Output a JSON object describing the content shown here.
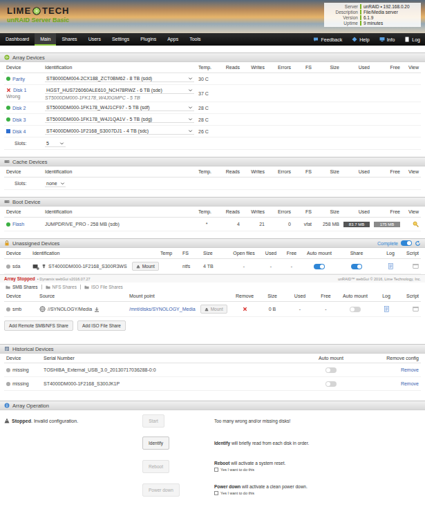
{
  "header": {
    "logo_left": "LIME",
    "logo_right": "TECH",
    "product": "unRAID Server Basic",
    "server_info": [
      {
        "label": "Server",
        "value": "unRAID • 192.168.0.20"
      },
      {
        "label": "Description",
        "value": "File/Media server"
      },
      {
        "label": "Version",
        "value": "6.1.9"
      },
      {
        "label": "Uptime",
        "value": "9 minutes"
      }
    ]
  },
  "nav": {
    "tabs": [
      {
        "label": "Dashboard",
        "selected": false
      },
      {
        "label": "Main",
        "selected": true
      },
      {
        "label": "Shares",
        "selected": false
      },
      {
        "label": "Users",
        "selected": false
      },
      {
        "label": "Settings",
        "selected": false
      },
      {
        "label": "Plugins",
        "selected": false
      },
      {
        "label": "Apps",
        "selected": false
      },
      {
        "label": "Tools",
        "selected": false
      }
    ],
    "links": [
      "Feedback",
      "Help",
      "Info",
      "Log"
    ]
  },
  "array_devices": {
    "title": "Array Devices",
    "columns": [
      "Device",
      "Identification",
      "Temp.",
      "Reads",
      "Writes",
      "Errors",
      "FS",
      "Size",
      "Used",
      "Free",
      "View"
    ],
    "rows": [
      {
        "device": "Parity",
        "kind": "dot",
        "color": "#3cb043",
        "identification": "ST8000DM004-2CX188_ZCT0BM62 - 8 TB (sdd)",
        "temp": "30 C"
      },
      {
        "device": "Disk 1",
        "kind": "cross",
        "color": "#d9302c",
        "identification": "HGST_HUS726060ALE610_NCH78RWZ - 6 TB (sde)",
        "temp": "37 C",
        "note": "Wrong",
        "note_detail": "ST5000DM000-1FK178_W4J0GMPC - 5 TB"
      },
      {
        "device": "Disk 2",
        "kind": "dot",
        "color": "#3cb043",
        "identification": "ST5000DM000-1FK178_W4J1CF97 - 5 TB (sdf)",
        "temp": "28 C"
      },
      {
        "device": "Disk 3",
        "kind": "dot",
        "color": "#3cb043",
        "identification": "ST5000DM000-1FK178_W4J1QA1V - 5 TB (sdg)",
        "temp": "28 C"
      },
      {
        "device": "Disk 4",
        "kind": "square",
        "color": "#2f6fd0",
        "identification": "ST4000DM000-1F2168_S3007DJ1 - 4 TB (sdc)",
        "temp": "26 C"
      }
    ],
    "slots": {
      "label": "Slots:",
      "value": "5"
    }
  },
  "cache_devices": {
    "title": "Cache Devices",
    "columns": [
      "Device",
      "Identification",
      "Temp.",
      "Reads",
      "Writes",
      "Errors",
      "FS",
      "Size",
      "Used",
      "Free",
      "View"
    ],
    "slots": {
      "label": "Slots:",
      "value": "none"
    }
  },
  "boot_device": {
    "title": "Boot Device",
    "columns": [
      "Device",
      "Identification",
      "Temp.",
      "Reads",
      "Writes",
      "Errors",
      "FS",
      "Size",
      "Used",
      "Free",
      "View"
    ],
    "rows": [
      {
        "device": "Flash",
        "identification": "JUMPDRIVE_PRO - 258 MB (sdb)",
        "temp": "*",
        "reads": "4",
        "writes": "21",
        "errors": "0",
        "fs": "vfat",
        "size": "258 MB",
        "used": "83.7 MB",
        "free": "175 MB"
      }
    ]
  },
  "unassigned_devices": {
    "title": "Unassigned Devices",
    "status": "Complete",
    "status_on": true,
    "columns": [
      "Device",
      "Identification",
      "Temp",
      "FS",
      "Size",
      "Open files",
      "Used",
      "Free",
      "Auto mount",
      "Share",
      "Log",
      "Script"
    ],
    "rows": [
      {
        "device": "sda",
        "identification": "ST4000DM000-1F2168_S300R3WS",
        "button": "Mount",
        "temp": "",
        "fs": "ntfs",
        "size": "4 TB",
        "open_files": "-",
        "used": "-",
        "free": "-",
        "auto_mount": true,
        "share": true
      }
    ]
  },
  "status_bar": {
    "state": "Array Stopped",
    "version": "• Dynamix webGui v2016.07.27",
    "copyright": "unRAID™ webGui © 2016, Lime Technology, Inc."
  },
  "share_tabs": [
    {
      "label": "SMB Shares",
      "selected": true
    },
    {
      "label": "NFS Shares",
      "selected": false
    },
    {
      "label": "ISO File Shares",
      "selected": false
    }
  ],
  "remote_shares": {
    "columns": [
      "Device",
      "Source",
      "Mount point",
      "Remove",
      "Size",
      "Used",
      "Free",
      "Auto mount",
      "Log",
      "Script"
    ],
    "rows": [
      {
        "device": "smb",
        "source": "//SYNOLOGY/Media",
        "mount_point": "/mnt/disks/SYNOLOGY_Media",
        "button": "Mount",
        "button_disabled": true,
        "size": "0 B",
        "used": "-",
        "free": "-",
        "auto_mount": false
      }
    ],
    "buttons": [
      "Add Remote SMB/NFS Share",
      "Add ISO File Share"
    ]
  },
  "historical_devices": {
    "title": "Historical Devices",
    "columns": [
      "Device",
      "Serial Number",
      "Auto mount",
      "Remove config"
    ],
    "rows": [
      {
        "device": "missing",
        "serial": "TOSHIBA_External_USB_3.0_20130717036288-0:0",
        "auto_mount": false,
        "action": "Remove"
      },
      {
        "device": "missing",
        "serial": "ST4000DM000-1F2168_S300JK1P",
        "auto_mount": false,
        "action": "Remove"
      }
    ]
  },
  "array_operation": {
    "title": "Array Operation",
    "status": "Stopped",
    "status_text": ". Invalid configuration.",
    "actions": [
      {
        "button": "Start",
        "disabled": true,
        "bold": "",
        "text": "Too many wrong and/or missing disks!"
      },
      {
        "button": "Identify",
        "disabled": false,
        "bold": "Identify",
        "text": " will briefly read from each disk in order."
      },
      {
        "button": "Reboot",
        "disabled": true,
        "bold": "Reboot",
        "text": " will activate a system reset.",
        "confirm": {
          "label": "Yes I want to do this",
          "checked": false
        }
      },
      {
        "button": "Power down",
        "disabled": true,
        "bold": "Power down",
        "text": " will activate a clean power down.",
        "confirm": {
          "label": "Yes I want to do this",
          "checked": false
        }
      }
    ]
  }
}
